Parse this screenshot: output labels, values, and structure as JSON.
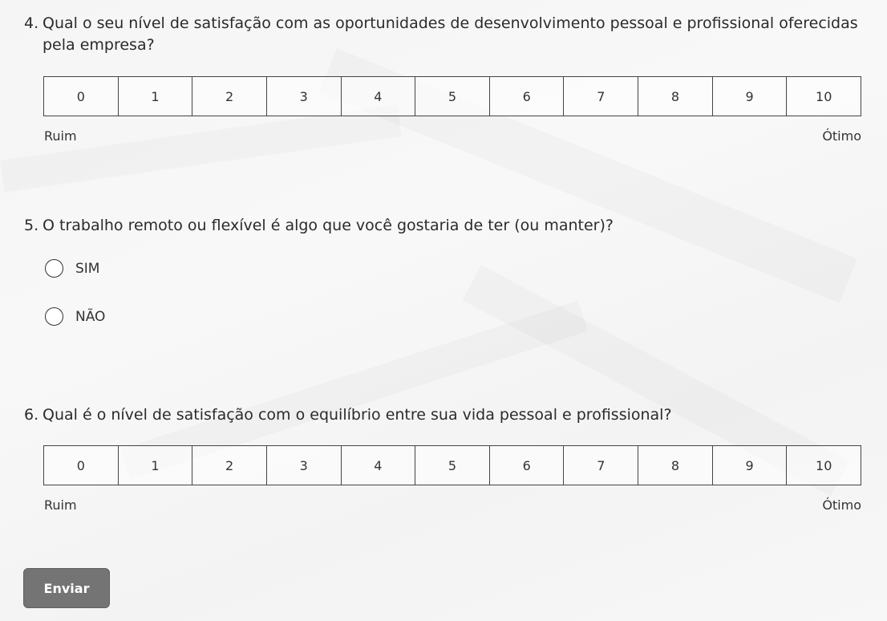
{
  "q4": {
    "number": "4.",
    "text": "Qual o seu nível de satisfação com as oportunidades de desenvolvimento pessoal e profissional oferecidas pela empresa?",
    "options": [
      "0",
      "1",
      "2",
      "3",
      "4",
      "5",
      "6",
      "7",
      "8",
      "9",
      "10"
    ],
    "low_label": "Ruim",
    "high_label": "Ótimo"
  },
  "q5": {
    "number": "5.",
    "text": "O trabalho remoto ou flexível é algo que você gostaria de ter (ou manter)?",
    "options": [
      "SIM",
      "NÃO"
    ]
  },
  "q6": {
    "number": "6.",
    "text": "Qual é o nível de satisfação com o equilíbrio entre sua vida pessoal e profissional?",
    "options": [
      "0",
      "1",
      "2",
      "3",
      "4",
      "5",
      "6",
      "7",
      "8",
      "9",
      "10"
    ],
    "low_label": "Ruim",
    "high_label": "Ótimo"
  },
  "submit_label": "Enviar"
}
